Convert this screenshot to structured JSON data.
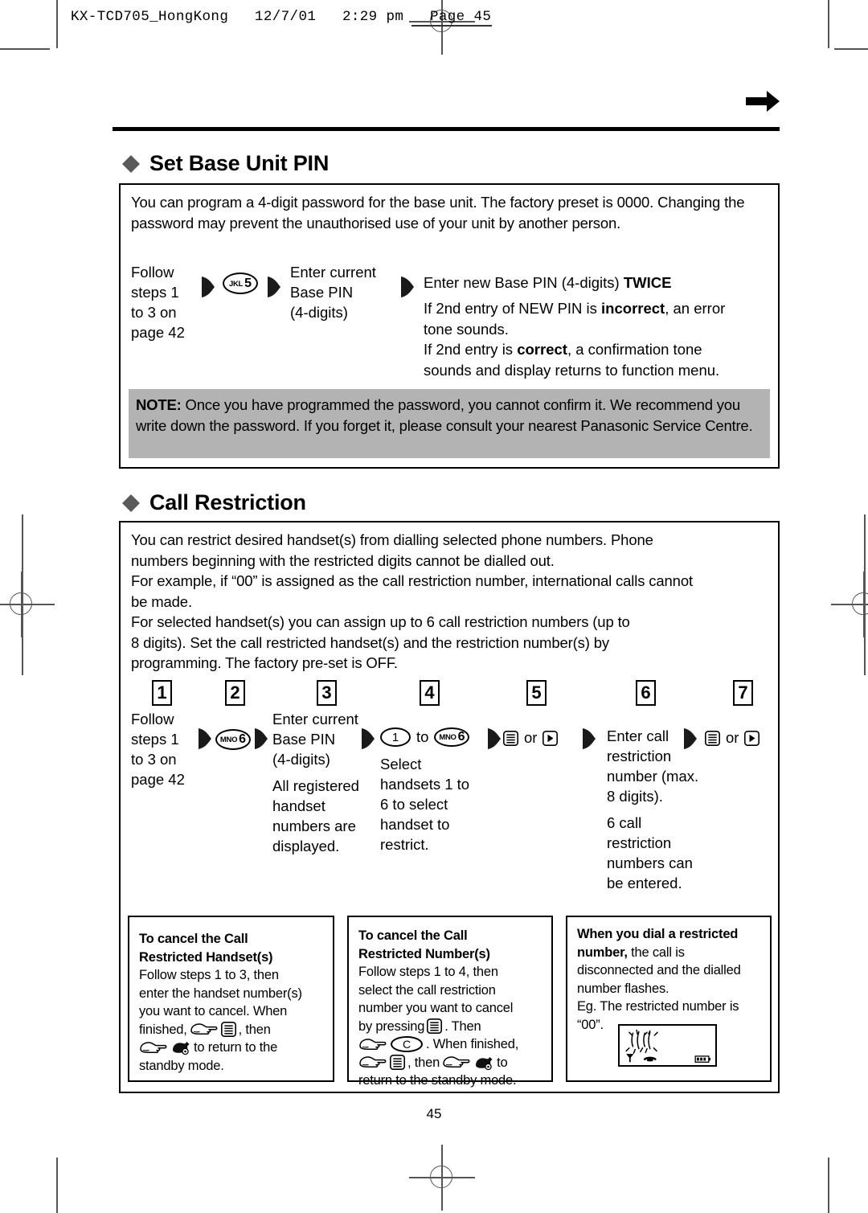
{
  "print_header": {
    "text": "KX-TCD705_HongKong   12/7/01   2:29 pm   Page 45"
  },
  "page_number": "45",
  "sections": [
    {
      "id": "set-base-unit-pin",
      "title": "Set Base Unit PIN",
      "intro": "You can program a 4-digit password for the base unit. The factory preset is 0000. Changing the password may prevent the unauthorised use of your unit by another person.",
      "steps": [
        {
          "lines": [
            "Follow",
            "steps 1",
            "to 3 on",
            "page 42"
          ]
        },
        {
          "key_sub": "JKL",
          "key_num": "5"
        },
        {
          "lines": [
            "Enter current",
            "Base PIN",
            "(4-digits)"
          ]
        }
      ],
      "final_step": {
        "heading_plain": "Enter new Base PIN  (4-digits) ",
        "heading_bold": "TWICE",
        "detail": [
          {
            "a": "If 2nd entry of NEW PIN is ",
            "b": "incorrect",
            "c": ", an error"
          },
          {
            "a": "tone sounds.",
            "b": "",
            "c": ""
          },
          {
            "a": "If 2nd entry is ",
            "b": "correct",
            "c": ", a confirmation tone"
          },
          {
            "a": "sounds and display returns to function menu.",
            "b": "",
            "c": ""
          }
        ]
      },
      "note": {
        "label": "NOTE:",
        "text": " Once you have programmed the password, you cannot confirm it. We recommend you write down the password. If you forget it, please consult your nearest Panasonic Service Centre."
      }
    },
    {
      "id": "call-restriction",
      "title": "Call Restriction",
      "intro_lines": [
        "You can restrict desired handset(s) from dialling selected phone numbers. Phone",
        "numbers beginning with the restricted digits cannot be dialled out.",
        "For example, if “00” is assigned as the call restriction number, international calls cannot",
        "be made.",
        "For selected handset(s) you can assign up to 6 call restriction numbers (up to",
        "8 digits). Set the call restricted handset(s) and the restriction number(s) by",
        "programming. The factory pre-set is OFF."
      ],
      "step_numbers": [
        "1",
        "2",
        "3",
        "4",
        "5",
        "6",
        "7"
      ],
      "steps": {
        "s1": [
          "Follow",
          "steps 1",
          "to 3 on",
          "page 42"
        ],
        "s2_key_sub": "MNO",
        "s2_key_num": "6",
        "s3_head": [
          "Enter current",
          "Base PIN",
          "(4-digits)"
        ],
        "s3_body": [
          "All registered",
          "handset",
          "numbers are",
          "displayed."
        ],
        "s4_key_a": "1",
        "s4_to": "to",
        "s4_key_b_sub": "MNO",
        "s4_key_b_num": "6",
        "s4_body": [
          "Select",
          "handsets 1 to",
          "6 to select",
          "handset to",
          "restrict."
        ],
        "s5_or": "or",
        "s6_head": [
          "Enter call",
          "restriction",
          "number (max.",
          "8 digits)."
        ],
        "s6_body": [
          "6 call",
          "restriction",
          "numbers can",
          "be entered."
        ],
        "s7_or": "or"
      },
      "tips": [
        {
          "id": "cancel-handsets",
          "title_lines": [
            "To cancel the Call",
            "Restricted Handset(s)"
          ],
          "body_lines": [
            "Follow steps 1 to 3, then",
            "enter the handset number(s)",
            "you want to cancel. When",
            "finished, [HAND][MENU], then",
            "[HAND][PHONEOFF] to return to the",
            "standby mode."
          ]
        },
        {
          "id": "cancel-numbers",
          "title_lines": [
            "To cancel the Call",
            "Restricted Number(s)"
          ],
          "body_lines": [
            "Follow steps 1 to 4, then",
            "select the call restriction",
            "number you want to cancel",
            "by pressing [MENU]. Then",
            "[HAND] [C]. When finished,",
            "[HAND] [MENU], then[HAND] [PHONEOFF] to",
            "return to the standby mode."
          ]
        },
        {
          "id": "dial-restricted",
          "title_bold": "When you dial a restricted number,",
          "title_rest": " the call is",
          "body_lines": [
            "disconnected and the dialled",
            "number flashes.",
            "Eg. The restricted number is",
            "“00”."
          ],
          "lcd": {
            "flashing_value": "00",
            "icons": [
              "antenna-icon",
              "phone-off-icon",
              "battery-icon"
            ]
          }
        }
      ]
    }
  ]
}
